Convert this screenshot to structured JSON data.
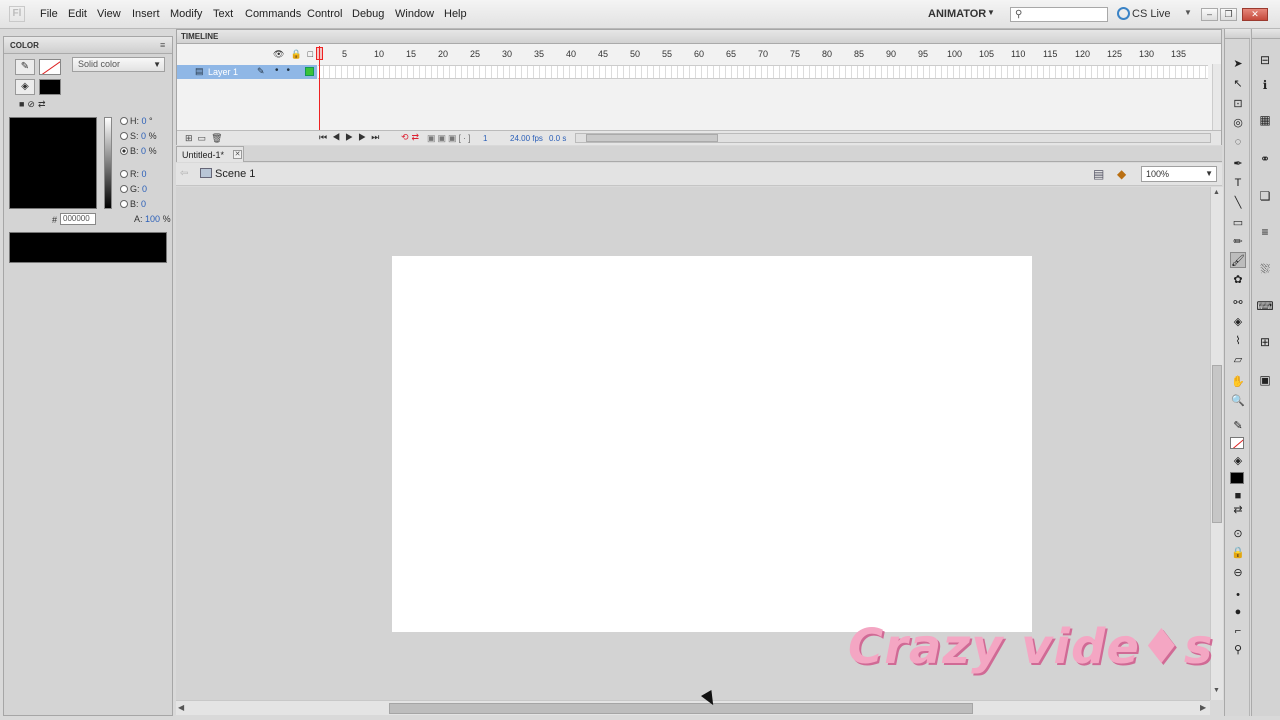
{
  "menubar": {
    "app_logo": "Fl",
    "items": [
      "File",
      "Edit",
      "View",
      "Insert",
      "Modify",
      "Text",
      "Commands",
      "Control",
      "Debug",
      "Window",
      "Help"
    ],
    "workspace": "ANIMATOR",
    "cs_live": "CS Live",
    "search_placeholder": "",
    "window_buttons": [
      "minimize-icon",
      "restore-icon",
      "close-icon"
    ]
  },
  "color_panel": {
    "title": "COLOR",
    "color_type": "Solid color",
    "hsb": [
      {
        "label": "H:",
        "value": "0",
        "unit": "°"
      },
      {
        "label": "S:",
        "value": "0",
        "unit": "%"
      },
      {
        "label": "B:",
        "value": "0",
        "unit": "%"
      }
    ],
    "rgb": [
      {
        "label": "R:",
        "value": "0"
      },
      {
        "label": "G:",
        "value": "0"
      },
      {
        "label": "B:",
        "value": "0"
      }
    ],
    "hex_label": "#",
    "hex_value": "000000",
    "alpha_label": "A:",
    "alpha_value": "100",
    "alpha_unit": "%",
    "stroke_color": "none",
    "fill_color": "#000000"
  },
  "timeline": {
    "title": "TIMELINE",
    "layer_name": "Layer 1",
    "frame_numbers": [
      "5",
      "10",
      "15",
      "20",
      "25",
      "30",
      "35",
      "40",
      "45",
      "50",
      "55",
      "60",
      "65",
      "70",
      "75",
      "80",
      "85",
      "90",
      "95",
      "100",
      "105",
      "110",
      "115",
      "120",
      "125",
      "130",
      "135"
    ],
    "current_frame": "1",
    "fps": "24.00 fps",
    "elapsed": "0.0 s"
  },
  "document": {
    "tab_label": "Untitled-1*",
    "scene_label": "Scene 1",
    "zoom": "100%",
    "stage_color": "#ffffff"
  },
  "watermark": {
    "text": "Crazy vide♦s"
  }
}
